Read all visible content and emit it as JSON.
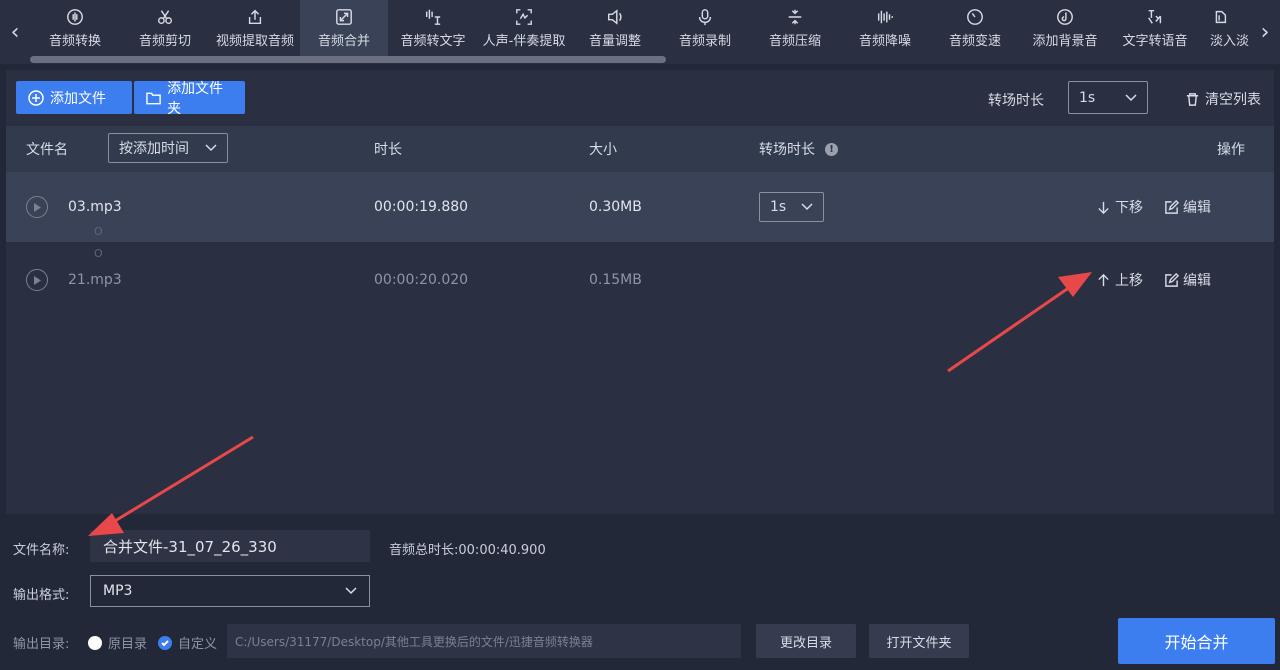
{
  "toolbar": {
    "tools": [
      {
        "label": "音频转换",
        "icon": "audio-wave-icon"
      },
      {
        "label": "音频剪切",
        "icon": "scissors-icon"
      },
      {
        "label": "视频提取音频",
        "icon": "export-icon"
      },
      {
        "label": "音频合并",
        "icon": "merge-icon",
        "active": true
      },
      {
        "label": "音频转文字",
        "icon": "speech-text-icon"
      },
      {
        "label": "人声-伴奏提取",
        "icon": "vocal-icon"
      },
      {
        "label": "音量调整",
        "icon": "volume-icon"
      },
      {
        "label": "音频录制",
        "icon": "microphone-icon"
      },
      {
        "label": "音频压缩",
        "icon": "compress-icon"
      },
      {
        "label": "音频降噪",
        "icon": "denoise-icon"
      },
      {
        "label": "音频变速",
        "icon": "speed-icon"
      },
      {
        "label": "添加背景音",
        "icon": "music-note-icon"
      },
      {
        "label": "文字转语音",
        "icon": "tts-icon"
      },
      {
        "label": "淡入淡",
        "icon": "fade-icon"
      }
    ]
  },
  "actions": {
    "add_file": "添加文件",
    "add_folder": "添加文件夹",
    "transition_label": "转场时长",
    "transition_value": "1s",
    "clear_list": "清空列表"
  },
  "table": {
    "col_name": "文件名",
    "sort_value": "按添加时间",
    "col_duration": "时长",
    "col_size": "大小",
    "col_transition": "转场时长",
    "col_ops": "操作",
    "rows": [
      {
        "name": "03.mp3",
        "duration": "00:00:19.880",
        "size": "0.30MB",
        "transition": "1s",
        "move": "下移",
        "edit": "编辑"
      },
      {
        "name": "21.mp3",
        "duration": "00:00:20.020",
        "size": "0.15MB",
        "transition": "",
        "move": "上移",
        "edit": "编辑"
      }
    ]
  },
  "bottom": {
    "filename_label": "文件名称:",
    "filename_value": "合并文件-31_07_26_330",
    "total_label": "音频总时长:",
    "total_value": "00:00:40.900",
    "format_label": "输出格式:",
    "format_value": "MP3",
    "outdir_label": "输出目录:",
    "radio_original": "原目录",
    "radio_custom": "自定义",
    "path": "C:/Users/31177/Desktop/其他工具更换后的文件/迅捷音频转换器",
    "change_dir": "更改目录",
    "open_folder": "打开文件夹",
    "start": "开始合并"
  }
}
